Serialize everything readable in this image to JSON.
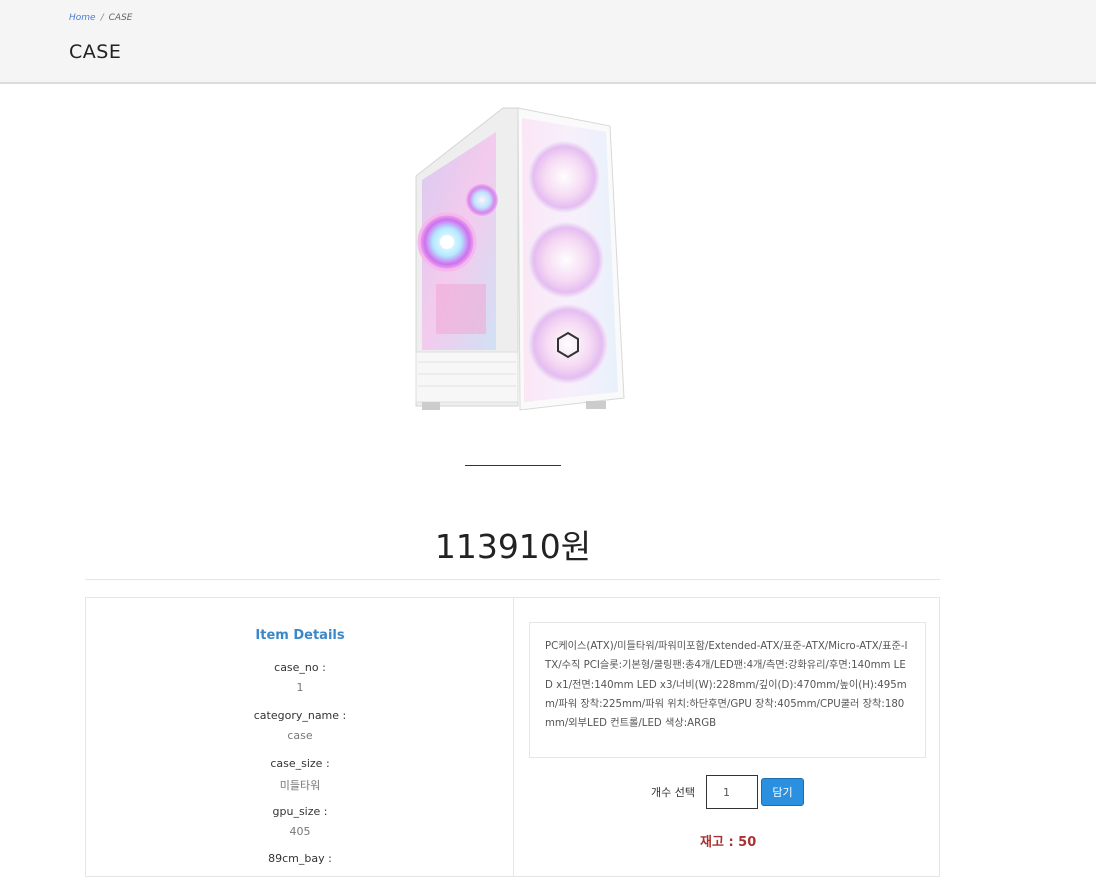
{
  "breadcrumb": {
    "home": "Home",
    "separator": "/",
    "current": "CASE"
  },
  "page": {
    "title": "CASE"
  },
  "product": {
    "image_alt": "white mid-tower PC case with ARGB fans",
    "price": "113910원",
    "description": "PC케이스(ATX)/미들타워/파워미포함/Extended-ATX/표준-ATX/Micro-ATX/표준-ITX/수직 PCI슬롯:기본형/쿨링팬:총4개/LED팬:4개/측면:강화유리/후면:140mm LED x1/전면:140mm LED x3/너비(W):228mm/깊이(D):470mm/높이(H):495mm/파워 장착:225mm/파워 위치:하단후면/GPU 장착:405mm/CPU쿨러 장착:180mm/외부LED 컨트롤/LED 색상:ARGB"
  },
  "details": {
    "title": "Item Details",
    "items": [
      {
        "key": "case_no :",
        "value": "1"
      },
      {
        "key": "category_name :",
        "value": "case"
      },
      {
        "key": "case_size :",
        "value": "미들타워"
      },
      {
        "key": "gpu_size :",
        "value": "405"
      },
      {
        "key": "89cm_bay :",
        "value": ""
      }
    ]
  },
  "order": {
    "qty_label": "개수 선택",
    "qty_value": "1",
    "add_label": "담기",
    "stock_label": "재고 : 50"
  },
  "colors": {
    "accent": "#2a90df",
    "title_blue": "#3a87c9",
    "stock_red": "#a83232"
  }
}
